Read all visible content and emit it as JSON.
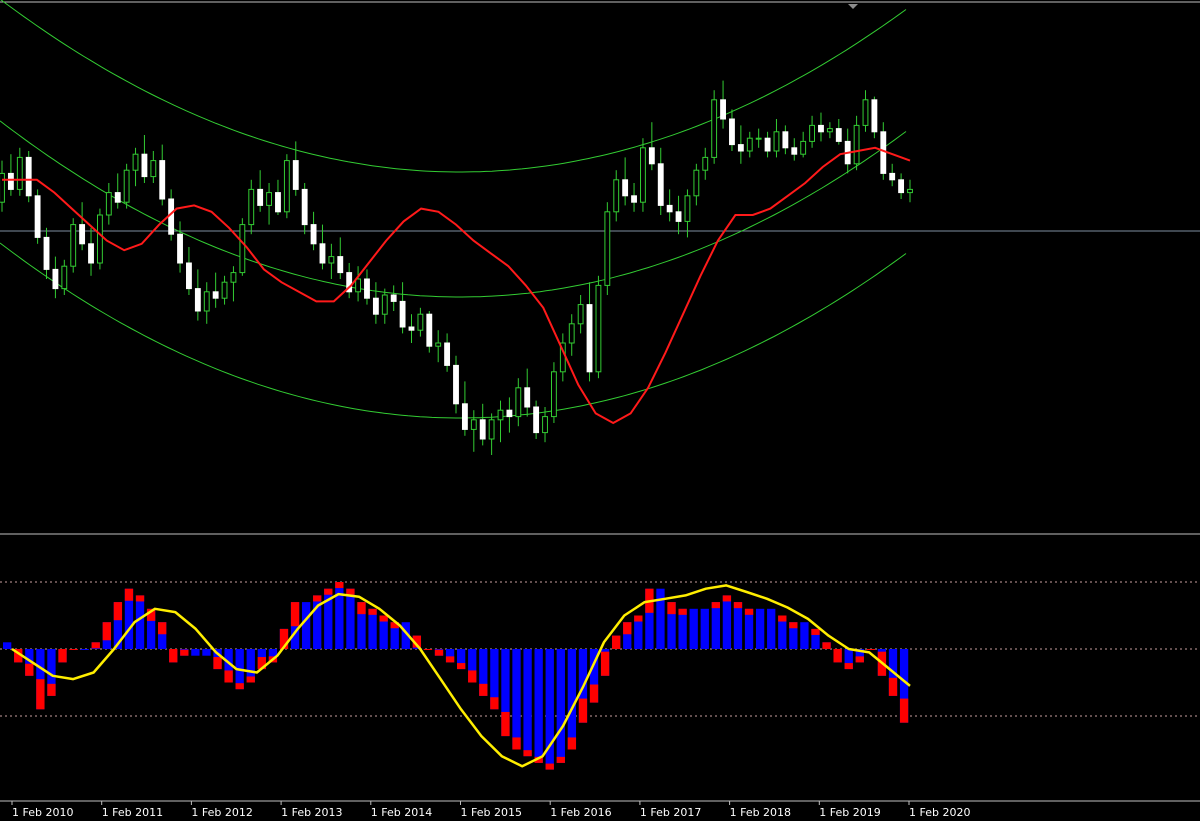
{
  "chart_data": [
    {
      "panel": "price",
      "type": "candlestick",
      "x_dates": [
        "1 Feb 2010",
        "1 Feb 2011",
        "1 Feb 2012",
        "1 Feb 2013",
        "1 Feb 2014",
        "1 Feb 2015",
        "1 Feb 2016",
        "1 Feb 2017",
        "1 Feb 2018",
        "1 Feb 2019",
        "1 Feb 2020"
      ],
      "candles": [
        [
          0.9,
          2.2,
          0.6,
          1.8
        ],
        [
          1.8,
          2.4,
          1.1,
          1.3
        ],
        [
          1.3,
          2.6,
          1.1,
          2.3
        ],
        [
          2.3,
          2.5,
          0.9,
          1.1
        ],
        [
          1.1,
          1.3,
          -0.4,
          -0.2
        ],
        [
          -0.2,
          0.1,
          -1.5,
          -1.2
        ],
        [
          -1.2,
          -0.8,
          -2.1,
          -1.8
        ],
        [
          -1.8,
          -0.9,
          -2.0,
          -1.1
        ],
        [
          -1.1,
          0.4,
          -1.3,
          0.2
        ],
        [
          0.2,
          0.9,
          -0.6,
          -0.4
        ],
        [
          -0.4,
          0.1,
          -1.4,
          -1.0
        ],
        [
          -1.0,
          0.7,
          -1.2,
          0.5
        ],
        [
          0.5,
          1.5,
          0.2,
          1.2
        ],
        [
          1.2,
          1.8,
          0.7,
          0.9
        ],
        [
          0.9,
          2.1,
          0.7,
          1.9
        ],
        [
          1.9,
          2.6,
          1.4,
          2.4
        ],
        [
          2.4,
          3.0,
          1.5,
          1.7
        ],
        [
          1.7,
          2.5,
          1.5,
          2.2
        ],
        [
          2.2,
          2.7,
          0.8,
          1.0
        ],
        [
          1.0,
          1.3,
          -0.3,
          -0.1
        ],
        [
          -0.1,
          0.3,
          -1.3,
          -1.0
        ],
        [
          -1.0,
          -0.5,
          -2.0,
          -1.8
        ],
        [
          -1.8,
          -1.2,
          -2.8,
          -2.5
        ],
        [
          -2.5,
          -1.6,
          -2.9,
          -1.9
        ],
        [
          -1.9,
          -1.3,
          -2.4,
          -2.1
        ],
        [
          -2.1,
          -1.4,
          -2.3,
          -1.6
        ],
        [
          -1.6,
          -1.1,
          -2.2,
          -1.3
        ],
        [
          -1.3,
          0.4,
          -1.4,
          0.2
        ],
        [
          0.2,
          1.6,
          -0.1,
          1.3
        ],
        [
          1.3,
          1.9,
          0.6,
          0.8
        ],
        [
          0.8,
          1.5,
          0.2,
          1.2
        ],
        [
          1.2,
          1.6,
          0.5,
          0.6
        ],
        [
          0.6,
          2.4,
          0.4,
          2.2
        ],
        [
          2.2,
          2.8,
          1.1,
          1.3
        ],
        [
          1.3,
          1.5,
          -0.1,
          0.2
        ],
        [
          0.2,
          0.6,
          -0.6,
          -0.4
        ],
        [
          -0.4,
          0.2,
          -1.2,
          -1.0
        ],
        [
          -1.0,
          -0.4,
          -1.5,
          -0.8
        ],
        [
          -0.8,
          -0.2,
          -1.5,
          -1.3
        ],
        [
          -1.3,
          -1.0,
          -2.1,
          -1.9
        ],
        [
          -1.9,
          -1.1,
          -2.2,
          -1.5
        ],
        [
          -1.5,
          -1.2,
          -2.3,
          -2.1
        ],
        [
          -2.1,
          -1.6,
          -2.9,
          -2.6
        ],
        [
          -2.6,
          -1.8,
          -2.9,
          -2.0
        ],
        [
          -2.0,
          -1.7,
          -2.5,
          -2.2
        ],
        [
          -2.2,
          -1.6,
          -3.2,
          -3.0
        ],
        [
          -3.0,
          -2.6,
          -3.5,
          -3.1
        ],
        [
          -3.1,
          -2.4,
          -3.3,
          -2.6
        ],
        [
          -2.6,
          -2.5,
          -3.8,
          -3.6
        ],
        [
          -3.6,
          -3.1,
          -4.1,
          -3.5
        ],
        [
          -3.5,
          -3.2,
          -4.4,
          -4.2
        ],
        [
          -4.2,
          -3.9,
          -5.7,
          -5.4
        ],
        [
          -5.4,
          -4.7,
          -6.4,
          -6.2
        ],
        [
          -6.2,
          -5.6,
          -6.9,
          -5.9
        ],
        [
          -5.9,
          -5.4,
          -6.7,
          -6.5
        ],
        [
          -6.5,
          -5.7,
          -7.0,
          -5.9
        ],
        [
          -5.9,
          -5.3,
          -6.6,
          -5.6
        ],
        [
          -5.6,
          -5.2,
          -6.3,
          -5.8
        ],
        [
          -5.8,
          -4.6,
          -6.1,
          -4.9
        ],
        [
          -4.9,
          -4.3,
          -5.8,
          -5.5
        ],
        [
          -5.5,
          -5.3,
          -6.5,
          -6.3
        ],
        [
          -6.3,
          -5.5,
          -6.6,
          -5.8
        ],
        [
          -5.8,
          -4.1,
          -6.0,
          -4.4
        ],
        [
          -4.4,
          -3.2,
          -4.7,
          -3.5
        ],
        [
          -3.5,
          -2.6,
          -3.9,
          -2.9
        ],
        [
          -2.9,
          -2.0,
          -3.2,
          -2.3
        ],
        [
          -2.3,
          -1.6,
          -4.7,
          -4.4
        ],
        [
          -4.4,
          -1.4,
          -4.6,
          -1.7
        ],
        [
          -1.7,
          0.9,
          -2.0,
          0.6
        ],
        [
          0.6,
          1.9,
          0.3,
          1.6
        ],
        [
          1.6,
          2.3,
          0.8,
          1.1
        ],
        [
          1.1,
          1.5,
          0.6,
          0.9
        ],
        [
          0.9,
          2.9,
          0.6,
          2.6
        ],
        [
          2.6,
          3.4,
          1.9,
          2.1
        ],
        [
          2.1,
          2.6,
          0.5,
          0.8
        ],
        [
          0.8,
          1.3,
          0.3,
          0.6
        ],
        [
          0.6,
          1.1,
          -0.1,
          0.3
        ],
        [
          0.3,
          1.3,
          -0.2,
          1.1
        ],
        [
          1.1,
          2.1,
          0.8,
          1.9
        ],
        [
          1.9,
          2.6,
          1.6,
          2.3
        ],
        [
          2.3,
          4.4,
          2.1,
          4.1
        ],
        [
          4.1,
          4.7,
          3.2,
          3.5
        ],
        [
          3.5,
          3.8,
          2.5,
          2.7
        ],
        [
          2.7,
          3.3,
          2.1,
          2.5
        ],
        [
          2.5,
          3.1,
          2.3,
          2.9
        ],
        [
          2.9,
          3.2,
          2.6,
          2.9
        ],
        [
          2.9,
          3.1,
          2.3,
          2.5
        ],
        [
          2.5,
          3.5,
          2.3,
          3.1
        ],
        [
          3.1,
          3.3,
          2.4,
          2.6
        ],
        [
          2.6,
          2.9,
          2.2,
          2.4
        ],
        [
          2.4,
          3.1,
          2.3,
          2.8
        ],
        [
          2.8,
          3.6,
          2.6,
          3.3
        ],
        [
          3.3,
          3.7,
          2.8,
          3.1
        ],
        [
          3.1,
          3.4,
          2.9,
          3.2
        ],
        [
          3.2,
          3.5,
          2.7,
          2.8
        ],
        [
          2.8,
          3.2,
          1.8,
          2.1
        ],
        [
          2.1,
          3.6,
          1.9,
          3.3
        ],
        [
          3.3,
          4.4,
          3.1,
          4.1
        ],
        [
          4.1,
          4.2,
          2.9,
          3.1
        ],
        [
          3.1,
          3.4,
          1.6,
          1.8
        ],
        [
          1.8,
          2.1,
          1.4,
          1.6
        ],
        [
          1.6,
          1.8,
          1.0,
          1.2
        ],
        [
          1.2,
          1.6,
          0.9,
          1.3
        ]
      ],
      "ma_red": [
        1.6,
        1.6,
        1.6,
        1.2,
        0.7,
        0.2,
        -0.3,
        -0.6,
        -0.4,
        0.2,
        0.7,
        0.8,
        0.6,
        0.1,
        -0.5,
        -1.2,
        -1.6,
        -1.9,
        -2.2,
        -2.2,
        -1.7,
        -1.0,
        -0.3,
        0.3,
        0.7,
        0.6,
        0.2,
        -0.3,
        -0.7,
        -1.1,
        -1.7,
        -2.4,
        -3.6,
        -4.8,
        -5.7,
        -6.0,
        -5.7,
        -4.9,
        -3.8,
        -2.6,
        -1.4,
        -0.3,
        0.5,
        0.5,
        0.7,
        1.1,
        1.5,
        2.0,
        2.4,
        2.5,
        2.6,
        2.4,
        2.2
      ],
      "envelope_bands": "three curved green bands",
      "reference_level": 0.0
    },
    {
      "panel": "oscillator",
      "type": "bar",
      "levels": [
        1.0,
        0.0,
        -1.0
      ],
      "histogram": [
        0.1,
        -0.2,
        -0.4,
        -0.9,
        -0.7,
        -0.2,
        0.0,
        0.0,
        0.1,
        0.4,
        0.7,
        0.9,
        0.8,
        0.6,
        0.4,
        -0.2,
        -0.1,
        -0.1,
        -0.1,
        -0.3,
        -0.5,
        -0.6,
        -0.5,
        -0.3,
        -0.2,
        0.3,
        0.7,
        0.7,
        0.8,
        0.9,
        1.0,
        0.9,
        0.7,
        0.6,
        0.5,
        0.4,
        0.4,
        0.2,
        0.0,
        -0.1,
        -0.2,
        -0.3,
        -0.5,
        -0.7,
        -0.9,
        -1.3,
        -1.5,
        -1.6,
        -1.7,
        -1.8,
        -1.7,
        -1.5,
        -1.1,
        -0.8,
        -0.4,
        0.2,
        0.4,
        0.5,
        0.9,
        0.9,
        0.7,
        0.6,
        0.6,
        0.6,
        0.7,
        0.8,
        0.7,
        0.6,
        0.6,
        0.6,
        0.5,
        0.4,
        0.4,
        0.3,
        0.1,
        -0.2,
        -0.3,
        -0.2,
        0.0,
        -0.4,
        -0.7,
        -1.1
      ],
      "signal_yellow": [
        0.0,
        -0.2,
        -0.4,
        -0.45,
        -0.35,
        0.0,
        0.4,
        0.6,
        0.55,
        0.3,
        -0.05,
        -0.3,
        -0.35,
        -0.1,
        0.3,
        0.65,
        0.82,
        0.78,
        0.6,
        0.35,
        0.0,
        -0.45,
        -0.9,
        -1.3,
        -1.6,
        -1.75,
        -1.6,
        -1.15,
        -0.55,
        0.1,
        0.5,
        0.7,
        0.75,
        0.8,
        0.9,
        0.95,
        0.85,
        0.75,
        0.62,
        0.45,
        0.2,
        0.0,
        -0.05,
        -0.3,
        -0.55
      ]
    }
  ]
}
